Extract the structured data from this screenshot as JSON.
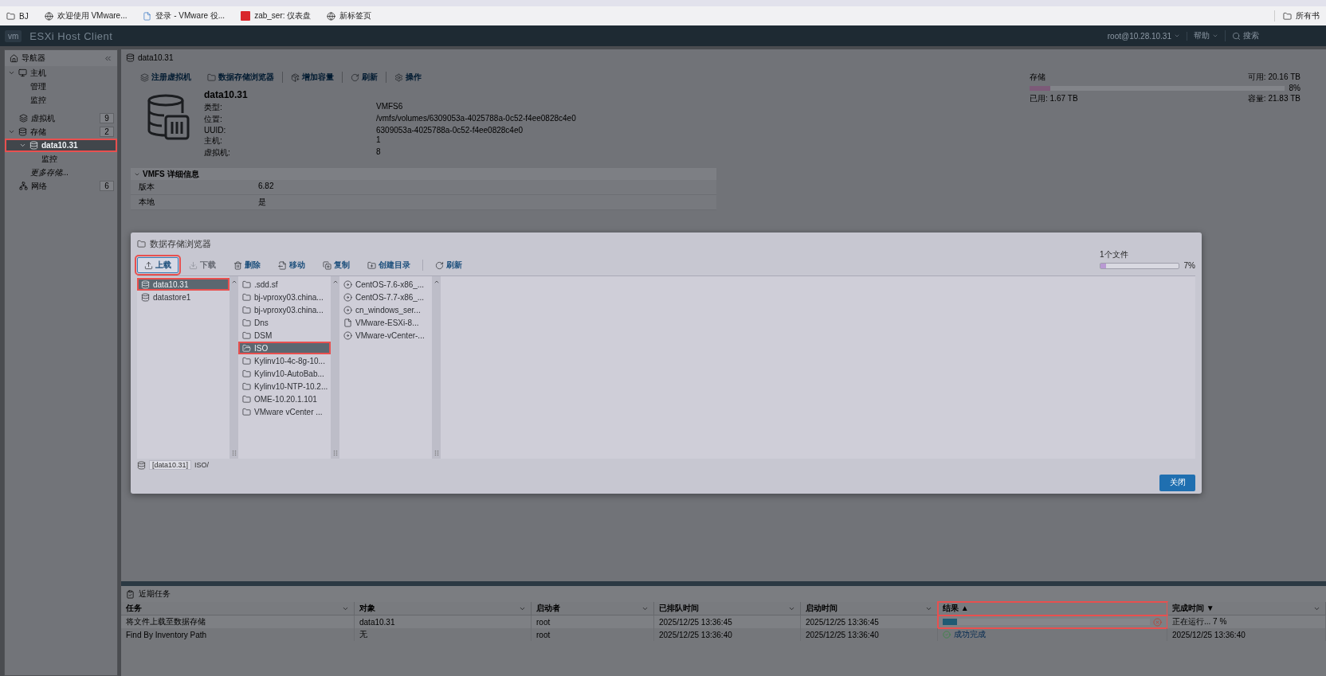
{
  "bookmarks": [
    {
      "label": "BJ"
    },
    {
      "label": "欢迎使用 VMware..."
    },
    {
      "label": "登录 - VMware 役..."
    },
    {
      "label": "zab_ser: 仪表盘"
    },
    {
      "label": "新标签页"
    }
  ],
  "all_bookmarks": "所有书",
  "app": {
    "logo": "vm",
    "title": "ESXi Host Client",
    "user": "root@10.28.10.31",
    "help": "帮助",
    "search": "搜索"
  },
  "navigator": {
    "title": "导航器",
    "items": [
      {
        "label": "主机",
        "expanded": true,
        "selected": false,
        "children": [
          {
            "label": "管理",
            "selected": false
          },
          {
            "label": "监控",
            "selected": false
          }
        ]
      },
      {
        "label": "虚拟机",
        "count": "9",
        "selected": false
      },
      {
        "label": "存储",
        "count": "2",
        "expanded": true,
        "selected": false,
        "children": [
          {
            "label": "data10.31",
            "expanded": true,
            "selected": true,
            "highlighted": true,
            "children": [
              {
                "label": "监控",
                "selected": false
              }
            ]
          },
          {
            "label": "更多存储...",
            "kind": "more",
            "selected": false
          }
        ]
      },
      {
        "label": "网络",
        "count": "6",
        "selected": false
      }
    ]
  },
  "page": {
    "title": "data10.31",
    "toolbar": [
      {
        "label": "注册虚拟机"
      },
      {
        "label": "数据存储浏览器"
      },
      {
        "label": "增加容量"
      },
      {
        "label": "刷新"
      },
      {
        "label": "操作"
      }
    ],
    "name": "data10.31",
    "properties": [
      {
        "label": "类型:",
        "value": "VMFS6"
      },
      {
        "label": "位置:",
        "value": "/vmfs/volumes/6309053a-4025788a-0c52-f4ee0828c4e0"
      },
      {
        "label": "UUID:",
        "value": "6309053a-4025788a-0c52-f4ee0828c4e0"
      },
      {
        "label": "主机:",
        "value": "1"
      },
      {
        "label": "虚拟机:",
        "value": "8"
      }
    ],
    "storage": {
      "title": "存储",
      "free": "可用: 20.16 TB",
      "level": 0.08,
      "percent": "8%",
      "used": "已用: 1.67 TB",
      "capacity": "容量: 21.83 TB"
    },
    "vmfs": {
      "title": "VMFS 详细信息",
      "expanded": true,
      "rows": [
        {
          "label": "版本",
          "value": "6.82"
        },
        {
          "label": "本地",
          "value": "是"
        }
      ]
    }
  },
  "dialog": {
    "title": "数据存储浏览器",
    "toolbar": [
      {
        "label": "上载",
        "disabled": false,
        "highlighted": true
      },
      {
        "label": "下载",
        "disabled": true,
        "highlighted": false
      },
      {
        "label": "删除",
        "disabled": false,
        "highlighted": false
      },
      {
        "label": "移动",
        "disabled": false,
        "highlighted": false
      },
      {
        "label": "复制",
        "disabled": false,
        "highlighted": false
      },
      {
        "label": "创建目录",
        "disabled": false,
        "highlighted": false
      },
      {
        "label": "刷新",
        "disabled": false,
        "highlighted": false
      }
    ],
    "upload": {
      "label": "1个文件",
      "level": 0.07,
      "percent": "7%"
    },
    "datastores": [
      {
        "label": "data10.31",
        "selected": true,
        "highlighted": true
      },
      {
        "label": "datastore1",
        "selected": false,
        "highlighted": false
      }
    ],
    "folders": [
      {
        "label": ".sdd.sf",
        "selected": false,
        "highlighted": false
      },
      {
        "label": "bj-vproxy03.china...",
        "selected": false,
        "highlighted": false
      },
      {
        "label": "bj-vproxy03.china...",
        "selected": false,
        "highlighted": false
      },
      {
        "label": "Dns",
        "selected": false,
        "highlighted": false
      },
      {
        "label": "DSM",
        "selected": false,
        "highlighted": false
      },
      {
        "label": "ISO",
        "selected": true,
        "highlighted": true
      },
      {
        "label": "Kylinv10-4c-8g-10...",
        "selected": false,
        "highlighted": false
      },
      {
        "label": "Kylinv10-AutoBab...",
        "selected": false,
        "highlighted": false
      },
      {
        "label": "Kylinv10-NTP-10.2...",
        "selected": false,
        "highlighted": false
      },
      {
        "label": "OME-10.20.1.101",
        "selected": false,
        "highlighted": false
      },
      {
        "label": "VMware vCenter ...",
        "selected": false,
        "highlighted": false
      }
    ],
    "files": [
      {
        "label": "CentOS-7.6-x86_...",
        "kind": "disc",
        "selected": false
      },
      {
        "label": "CentOS-7.7-x86_...",
        "kind": "disc",
        "selected": false
      },
      {
        "label": "cn_windows_ser...",
        "kind": "disc",
        "selected": false
      },
      {
        "label": "VMware-ESXi-8...",
        "kind": "file",
        "selected": false
      },
      {
        "label": "VMware-vCenter-...",
        "kind": "disc",
        "selected": false
      }
    ],
    "path": {
      "datastore": "[data10.31]",
      "folder": "ISO/"
    },
    "close": "关闭"
  },
  "tasks": {
    "title": "近期任务",
    "columns": [
      {
        "label": "任务",
        "menu": true,
        "highlighted": false
      },
      {
        "label": "对象",
        "menu": true,
        "highlighted": false
      },
      {
        "label": "启动者",
        "menu": true,
        "highlighted": false
      },
      {
        "label": "已排队时间",
        "menu": true,
        "highlighted": false
      },
      {
        "label": "启动时间",
        "menu": true,
        "highlighted": false
      },
      {
        "label": "结果 ▲",
        "menu": false,
        "highlighted": true
      },
      {
        "label": "完成时间 ▼",
        "menu": true,
        "highlighted": false
      }
    ],
    "rows": [
      {
        "task": "将文件上载至数据存储",
        "target": "data10.31",
        "initiator": "root",
        "queued": "2025/12/25 13:36:45",
        "started": "2025/12/25 13:36:45",
        "result": {
          "kind": "progress",
          "level": 0.07,
          "cancelable": true
        },
        "completed": "正在运行... 7 %"
      },
      {
        "task": "Find By Inventory Path",
        "target": "无",
        "initiator": "root",
        "queued": "2025/12/25 13:36:40",
        "started": "2025/12/25 13:36:40",
        "result": {
          "kind": "success",
          "label": "成功完成"
        },
        "completed": "2025/12/25 13:36:40"
      }
    ]
  }
}
